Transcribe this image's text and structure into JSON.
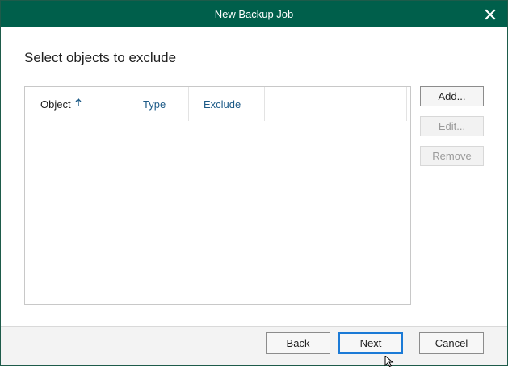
{
  "window": {
    "title": "New Backup Job",
    "close_icon": "close-icon"
  },
  "page": {
    "heading": "Select objects to exclude"
  },
  "grid": {
    "columns": [
      {
        "label": "Object",
        "sorted": "ascending"
      },
      {
        "label": "Type"
      },
      {
        "label": "Exclude"
      }
    ],
    "rows": []
  },
  "side_buttons": {
    "add": "Add...",
    "edit": "Edit...",
    "remove": "Remove"
  },
  "footer": {
    "back": "Back",
    "next": "Next",
    "cancel": "Cancel"
  },
  "colors": {
    "titlebar": "#005f4b",
    "column_link": "#1c5a87",
    "default_button_border": "#1b7ad6"
  }
}
